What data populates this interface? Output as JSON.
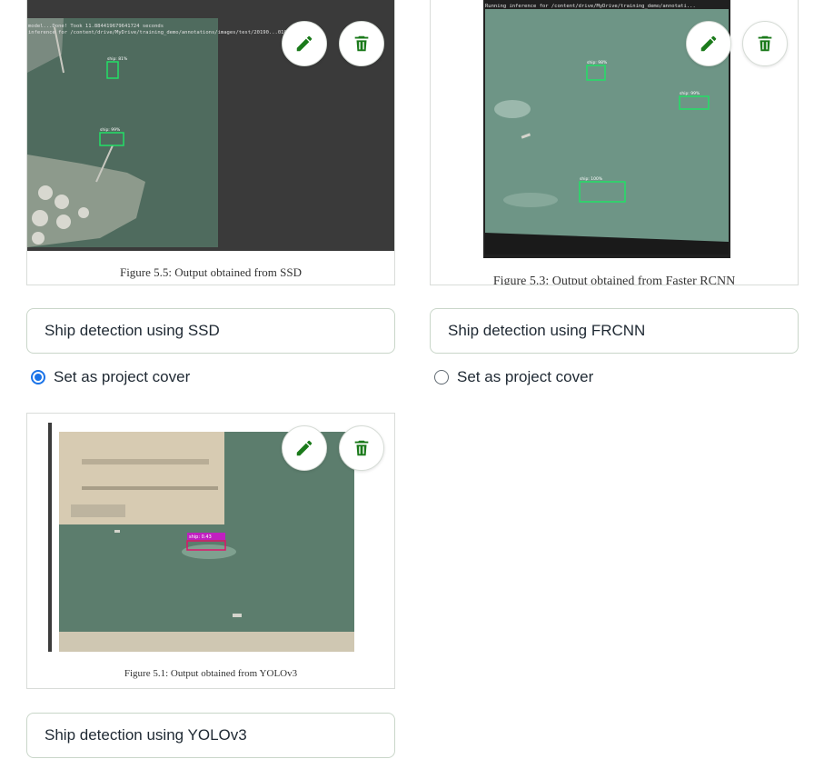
{
  "accent_color": "#1b7a1b",
  "radio_color": "#1a73e8",
  "cards": [
    {
      "figure_caption": "Figure 5.5: Output obtained from SSD",
      "console_lines": [
        "model...Done! Took 11.884419679641724 seconds",
        "inference for /content/drive/MyDrive/training_demo/annotations/images/test/20190...010_36...-1g..."
      ],
      "detections": [
        "ship: 81%",
        "ship: 99%"
      ],
      "title": "Ship detection using SSD",
      "cover_label": "Set as project cover",
      "cover_selected": true,
      "edit_icon": "pencil-icon",
      "delete_icon": "trash-icon"
    },
    {
      "figure_caption": "Figure 5.3: Output obtained from Faster RCNN",
      "console_lines": [
        "Running inference for /content/drive/MyDrive/training_demo/annotati..."
      ],
      "detections": [
        "ship: 98%",
        "ship: 99%",
        "ship: 100%"
      ],
      "title": "Ship detection using FRCNN",
      "cover_label": "Set as project cover",
      "cover_selected": false,
      "edit_icon": "pencil-icon",
      "delete_icon": "trash-icon"
    },
    {
      "figure_caption": "Figure 5.1: Output obtained from YOLOv3",
      "detections": [
        "ship: 0.43"
      ],
      "title": "Ship detection using YOLOv3",
      "edit_icon": "pencil-icon",
      "delete_icon": "trash-icon"
    }
  ]
}
